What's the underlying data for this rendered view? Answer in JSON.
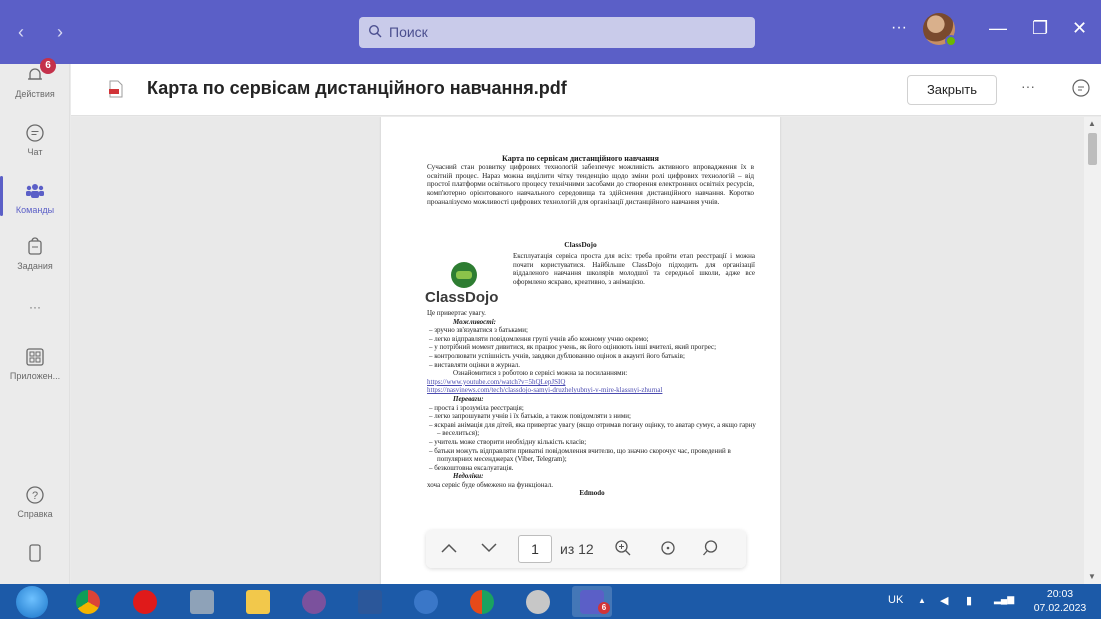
{
  "titlebar": {
    "back": "‹",
    "forward": "›",
    "search_placeholder": "Поиск",
    "more": "···",
    "minimize": "—",
    "maximize": "❐",
    "close": "✕"
  },
  "leftrail": {
    "items": [
      {
        "label": "Действия",
        "badge": "6"
      },
      {
        "label": "Чат"
      },
      {
        "label": "Команды"
      },
      {
        "label": "Задания"
      },
      {
        "label": "···"
      },
      {
        "label": "Приложен..."
      },
      {
        "label": "Справка"
      }
    ]
  },
  "document": {
    "title": "Карта по сервісам дистанційного навчання.pdf",
    "close_label": "Закрыть",
    "more": "···"
  },
  "page": {
    "title": "Карта по сервісам дистанційного навчання",
    "intro": "Сучасний стан розвитку цифрових технологій забезпечує можливість активного впровадження їх в освітній процес. Нараз можна виділити чітку тенденцію щодо зміни ролі цифрових технологій – від простої платформи освітнього процесу технічними засобами до створення електронних освітніх ресурсів, комп'ютерно орієнтованого навчального середовища та здійснення дистанційного навчання. Коротко проаналізуємо можливості цифрових технологій для організації дистанційного навчання учнів.",
    "classdojo_heading": "ClassDojo",
    "logo_text": "ClassDojo",
    "classdojo_para": "Експлуатація сервіса проста для всіх: треба пройти етап реєстрації і можна почати користуватися. Найбільше ClassDojo підходить для організації віддаленого навчання школярів молодшої та середньої школи, адже все оформлено яскраво, креативно, з анімацією.",
    "attention": "Це привертає увагу.",
    "advantages_heading": "Можливості:",
    "advantages": [
      "зручно зв'язуватися з батьками;",
      "легко відправляти повідомлення групі учнів або кожному учню окремо;",
      "у потрібний момент дивитися, як працює учень, як його оцінюють інші вчителі, який прогрес;",
      "контролювати успішність учнів, завдяки дублюванню оцінок в акаунті його батьків;",
      "виставляти оцінки в журнал."
    ],
    "familiar_line": "Ознайомитися з роботою в сервісі можна за посиланнями:",
    "link1": "https://www.youtube.com/watch?v=5hQLepJSIQ",
    "link2": "https://nasvinews.com/tech/classdojo-samyi-druzhelyubnyi-v-mire-klassnyi-zhurnal",
    "pluses_heading": "Переваги:",
    "pluses": [
      "проста і зрозуміла реєстрація;",
      "легко запрошувати учнів і їх батьків, а також повідомляти з ними;",
      "яскраві анімація для дітей, яка привертає увагу (якщо отримав погану оцінку, то аватар сумує, а якщо гарну – веселиться);",
      "учитель може створити необхідну кількість класів;",
      "батьки можуть відправляти приватні повідомлення вчителю, що значно скорочує час, проведений в популярних месенджерах (Viber, Telegram);",
      "безкоштовна ексалуатація."
    ],
    "cons_heading": "Недоліки:",
    "tail": "хоча сервіс буде обмежено на функціонал.",
    "edmodo_heading": "Edmodo"
  },
  "pdf_toolbar": {
    "page_value": "1",
    "of_label": "из 12"
  },
  "taskbar": {
    "lang": "UK",
    "time": "20:03",
    "date": "07.02.2023",
    "teams_badge": "6"
  }
}
